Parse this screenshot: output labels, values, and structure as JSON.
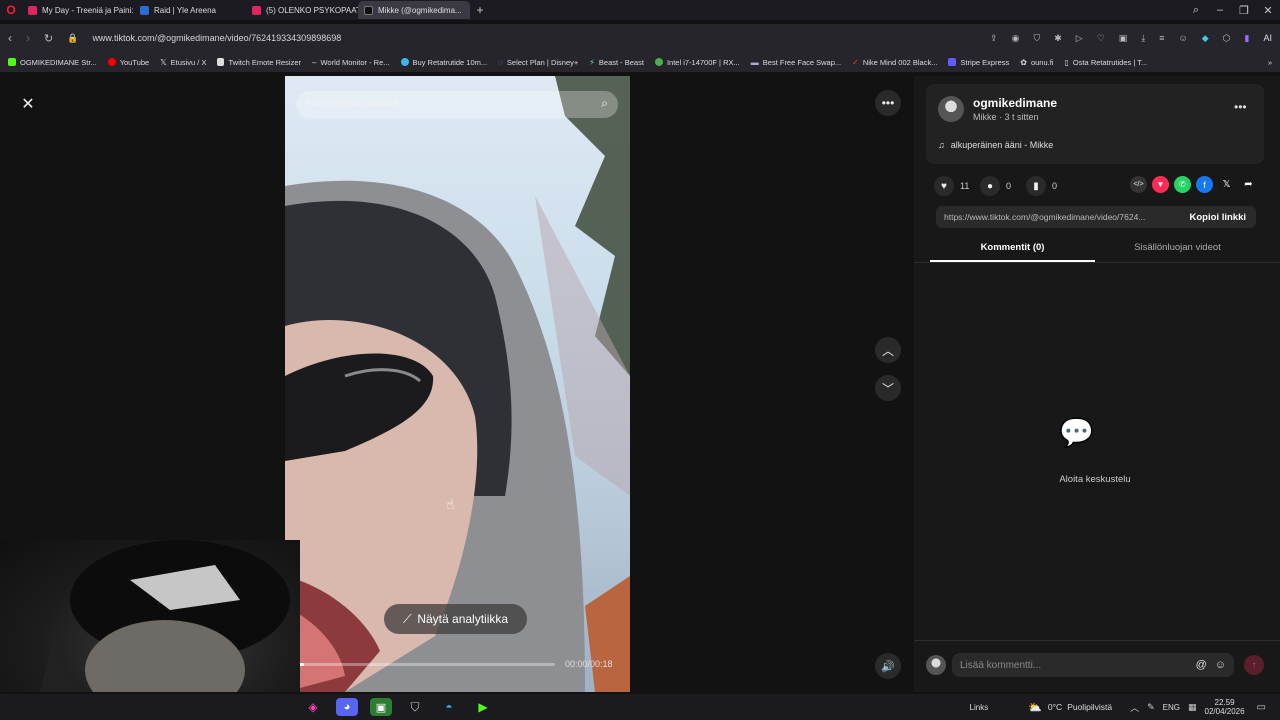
{
  "tabs": [
    {
      "label": "My Day - Treeniä ja Paini:",
      "color": "#e0245e",
      "active": false
    },
    {
      "label": "Raid | Yle Areena",
      "color": "#2c6cd6",
      "active": false
    },
    {
      "label": "(5) OLENKO PSYKOPAATTI",
      "color": "#e0245e",
      "active": false
    },
    {
      "label": "Mikke (@ogmikedima...",
      "color": "#111111",
      "active": true
    }
  ],
  "address": {
    "url": "www.tiktok.com/@ogmikedimane/video/762419334309898698"
  },
  "bookmarks": [
    "OGMIKEDIMANE Str...",
    "YouTube",
    "Etusivu / X",
    "Twitch Emote Resizer",
    "World Monitor - Re...",
    "Buy Retatrutide 10m...",
    "Select Plan | Disney+",
    "Beast - Beast",
    "Intel i7-14700F | RX...",
    "Best Free Face Swap...",
    "Nike Mind 002 Black...",
    "Stripe Express",
    "ounu.fi",
    "Osta Retatrutides | T..."
  ],
  "browser": {
    "ai_label": "AI"
  },
  "video": {
    "search_placeholder": "Hae liittyvää sisältöä",
    "analytics_label": "Näytä analytiikka",
    "time": "00:00/00:18",
    "progress": 0.03
  },
  "profile": {
    "username": "ogmikedimane",
    "subline": "Mikke · 3 t sitten",
    "sound": "alkuperäinen ääni - Mikke"
  },
  "stats": {
    "likes": "11",
    "comments": "0",
    "saves": "0"
  },
  "share": {
    "url": "https://www.tiktok.com/@ogmikedimane/video/7624...",
    "copy_label": "Kopioi linkki"
  },
  "panel_tabs": {
    "comments": "Kommentit (0)",
    "creator_videos": "Sisällönluojan videot"
  },
  "empty_state": "Aloita keskustelu",
  "comment_placeholder": "Lisää kommentti...",
  "taskbar": {
    "links": "Links",
    "weather": "0°C",
    "weather_desc": "Puolipilvistä",
    "lang": "ENG",
    "time": "22.59",
    "date": "02/04/2026"
  },
  "colors": {
    "tiktok_red": "#fe2c55",
    "panel": "#181818"
  }
}
